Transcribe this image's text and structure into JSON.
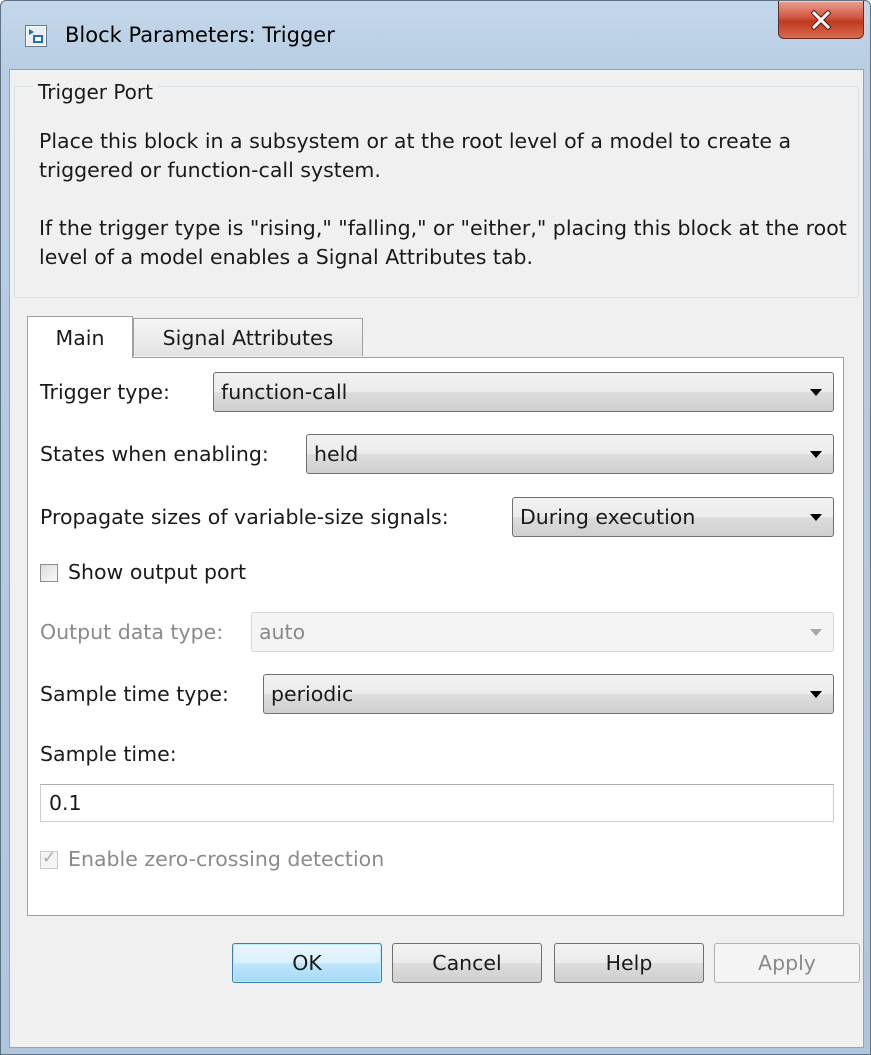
{
  "window": {
    "title": "Block Parameters: Trigger",
    "close_glyph": "✕"
  },
  "description": {
    "group_title": "Trigger Port",
    "paragraph1": "Place this block in a subsystem or at the root level of a model to create a triggered or function-call system.",
    "paragraph2": "If the trigger type is \"rising,\" \"falling,\" or \"either,\" placing this block at the root level of a model enables a Signal Attributes tab."
  },
  "tabs": [
    {
      "label": "Main",
      "selected": true
    },
    {
      "label": "Signal Attributes",
      "selected": false
    }
  ],
  "params": {
    "trigger_type": {
      "label": "Trigger type:",
      "value": "function-call"
    },
    "states_when_enabling": {
      "label": "States when enabling:",
      "value": "held"
    },
    "propagate_sizes": {
      "label": "Propagate sizes of variable-size signals:",
      "value": "During execution"
    },
    "show_output_port": {
      "label": "Show output port",
      "checked": false
    },
    "output_data_type": {
      "label": "Output data type:",
      "value": "auto",
      "enabled": false
    },
    "sample_time_type": {
      "label": "Sample time type:",
      "value": "periodic"
    },
    "sample_time": {
      "label": "Sample time:",
      "value": "0.1"
    },
    "zero_crossing": {
      "label": "Enable zero-crossing detection",
      "checked": true,
      "enabled": false
    }
  },
  "buttons": {
    "ok": "OK",
    "cancel": "Cancel",
    "help": "Help",
    "apply": "Apply"
  },
  "icons": {
    "app": "simulink-block-icon",
    "close": "close-icon",
    "dropdown": "chevron-down-icon",
    "check": "checkmark-icon"
  },
  "colors": {
    "title_bar": "#b8cde3",
    "close_button": "#c8452c",
    "default_button": "#a7d9f5",
    "client_bg": "#f0f0f0"
  }
}
